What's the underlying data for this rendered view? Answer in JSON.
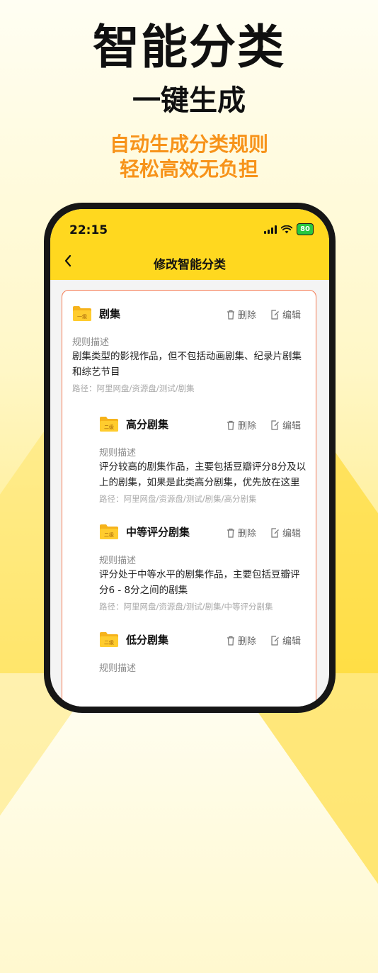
{
  "promo": {
    "title": "智能分类",
    "subtitle": "一键生成",
    "tagline1": "自动生成分类规则",
    "tagline2": "轻松高效无负担"
  },
  "status_bar": {
    "time": "22:15",
    "battery": "80"
  },
  "nav": {
    "title": "修改智能分类"
  },
  "actions": {
    "delete": "删除",
    "edit": "编辑"
  },
  "categories": [
    {
      "level_badge": "一级",
      "name": "剧集",
      "rule_label": "规则描述",
      "rule": "剧集类型的影视作品，但不包括动画剧集、纪录片剧集和综艺节目",
      "path": "路径：阿里网盘/资源盘/测试/剧集"
    },
    {
      "level_badge": "二级",
      "name": "高分剧集",
      "rule_label": "规则描述",
      "rule": "评分较高的剧集作品，主要包括豆瓣评分8分及以上的剧集，如果是此类高分剧集，优先放在这里",
      "path": "路径：阿里网盘/资源盘/测试/剧集/高分剧集"
    },
    {
      "level_badge": "二级",
      "name": "中等评分剧集",
      "rule_label": "规则描述",
      "rule": "评分处于中等水平的剧集作品，主要包括豆瓣评分6 - 8分之间的剧集",
      "path": "路径：阿里网盘/资源盘/测试/剧集/中等评分剧集"
    },
    {
      "level_badge": "二级",
      "name": "低分剧集",
      "rule_label": "规则描述"
    }
  ],
  "colors": {
    "accent_yellow": "#ffd81f",
    "accent_orange": "#f7931a",
    "card_border": "#f47a52"
  }
}
